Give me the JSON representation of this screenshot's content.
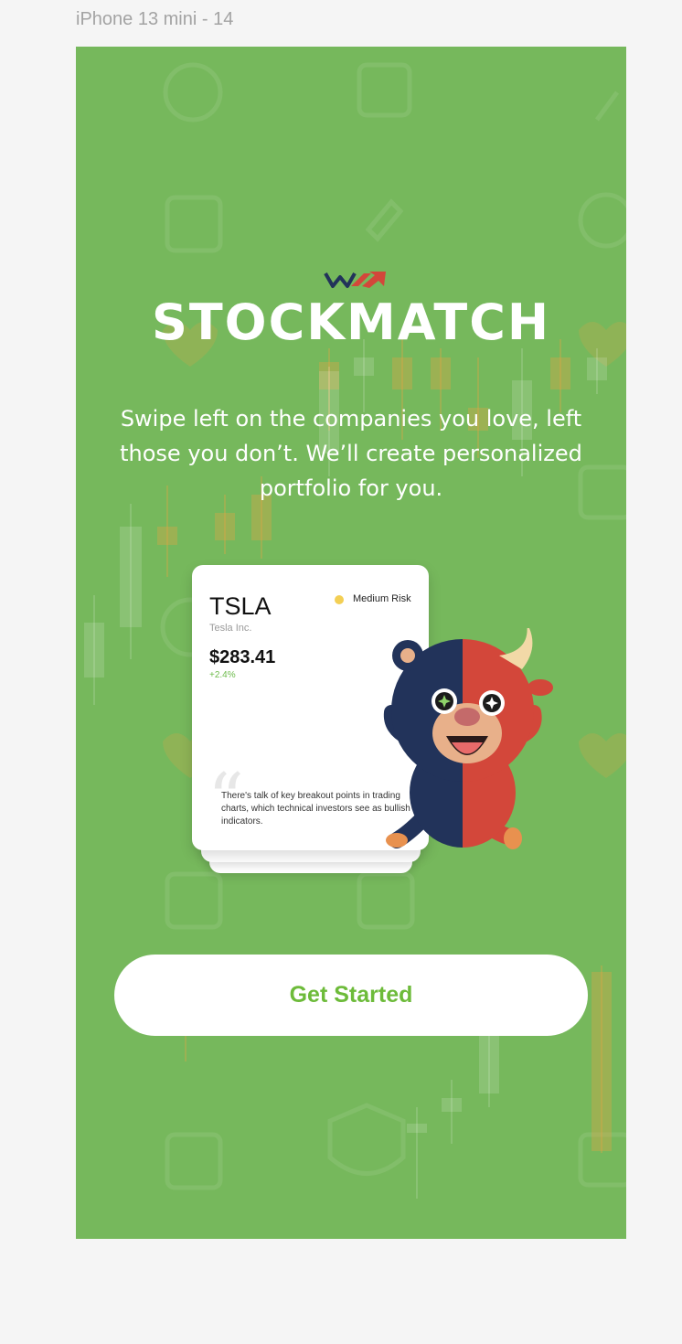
{
  "frame": {
    "label": "iPhone 13 mini - 14"
  },
  "brand": {
    "name": "STOCKMATCH"
  },
  "tagline": {
    "lines": [
      "Swipe left on the companies you love, left",
      "those you don’t. We’ll create personalized",
      "portfolio for you."
    ]
  },
  "card": {
    "ticker": "TSLA",
    "company": "Tesla Inc.",
    "risk_label": "Medium Risk",
    "price": "$283.41",
    "change": "+2.4%",
    "quote": "There's talk of key breakout points in trading charts, which technical investors see as bullish indicators."
  },
  "cta": {
    "label": "Get Started"
  },
  "colors": {
    "background": "#76b85c",
    "cta_text": "#6dbb3a",
    "risk_medium": "#f3cf54",
    "change_positive": "#6dbb4b",
    "bear": "#22335a",
    "bull": "#d3473a"
  },
  "icons": [
    "stockmatch-logo-icon",
    "quote-icon",
    "bull-bear-mascot"
  ]
}
